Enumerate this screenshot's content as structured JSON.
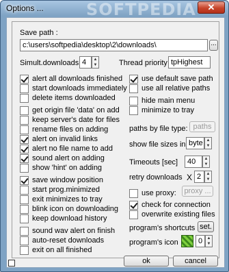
{
  "window": {
    "title": "Options ...",
    "watermark": "SOFTPEDIA",
    "close_label": "✕"
  },
  "save_path": {
    "label": "Save path :",
    "value": "c:\\users\\softpedia\\desktop\\2\\downloads\\",
    "browse_label": "..."
  },
  "simult": {
    "label": "Simult.downloads",
    "value": "4"
  },
  "priority": {
    "label": "Thread priority",
    "value": "tpHighest"
  },
  "left_options": [
    {
      "label": "alert all downloads finished",
      "checked": true
    },
    {
      "label": "start downloads immediately",
      "checked": false
    },
    {
      "label": "delete items downloaded",
      "checked": false
    },
    {
      "label": "get origin file 'data' on add",
      "checked": false
    },
    {
      "label": "keep server's date for files",
      "checked": false
    },
    {
      "label": "rename files on adding",
      "checked": false
    },
    {
      "label": "alert on invalid links",
      "checked": true
    },
    {
      "label": "alert no file name to add",
      "checked": true
    },
    {
      "label": "sound alert on adding",
      "checked": true
    },
    {
      "label": "show 'hint' on adding",
      "checked": false
    },
    {
      "label": "save window position",
      "checked": true
    },
    {
      "label": "start prog.minimized",
      "checked": false
    },
    {
      "label": "exit minimizes to tray",
      "checked": false
    },
    {
      "label": "blink icon on downloading",
      "checked": false
    },
    {
      "label": "keep download history",
      "checked": false
    },
    {
      "label": "sound wav alert on finish",
      "checked": false
    },
    {
      "label": "auto-reset downloads",
      "checked": false
    },
    {
      "label": "exit on all finished",
      "checked": false
    }
  ],
  "right_options": [
    {
      "label": "use default save path",
      "checked": true
    },
    {
      "label": "use all  relative paths",
      "checked": false
    },
    {
      "label": "hide main menu",
      "checked": false
    },
    {
      "label": "minimize to tray",
      "checked": false
    }
  ],
  "paths_by_type": {
    "label": "paths by file type:",
    "button": "paths"
  },
  "file_sizes": {
    "label": "show file sizes in",
    "value": "byte"
  },
  "timeouts": {
    "label": "Timeouts [sec]",
    "value": "40"
  },
  "retry": {
    "label": "retry downloads",
    "times": "X",
    "value": "2"
  },
  "proxy": {
    "label": "use proxy:",
    "checked": false,
    "button": "proxy ..."
  },
  "check_connection": {
    "label": "check for connection",
    "checked": true
  },
  "overwrite": {
    "label": "overwrite existing files",
    "checked": false
  },
  "shortcuts": {
    "label": "program's shortcuts",
    "button": "set."
  },
  "prog_icon": {
    "label": "program's icon",
    "value": "0"
  },
  "footer": {
    "ok": "ok",
    "cancel": "cancel"
  },
  "colors": {
    "title_bar": "#7fa3c4",
    "close_button": "#c7442a",
    "dialog_bg": "#f0f0f0",
    "icon_green": "#5fae2e"
  }
}
